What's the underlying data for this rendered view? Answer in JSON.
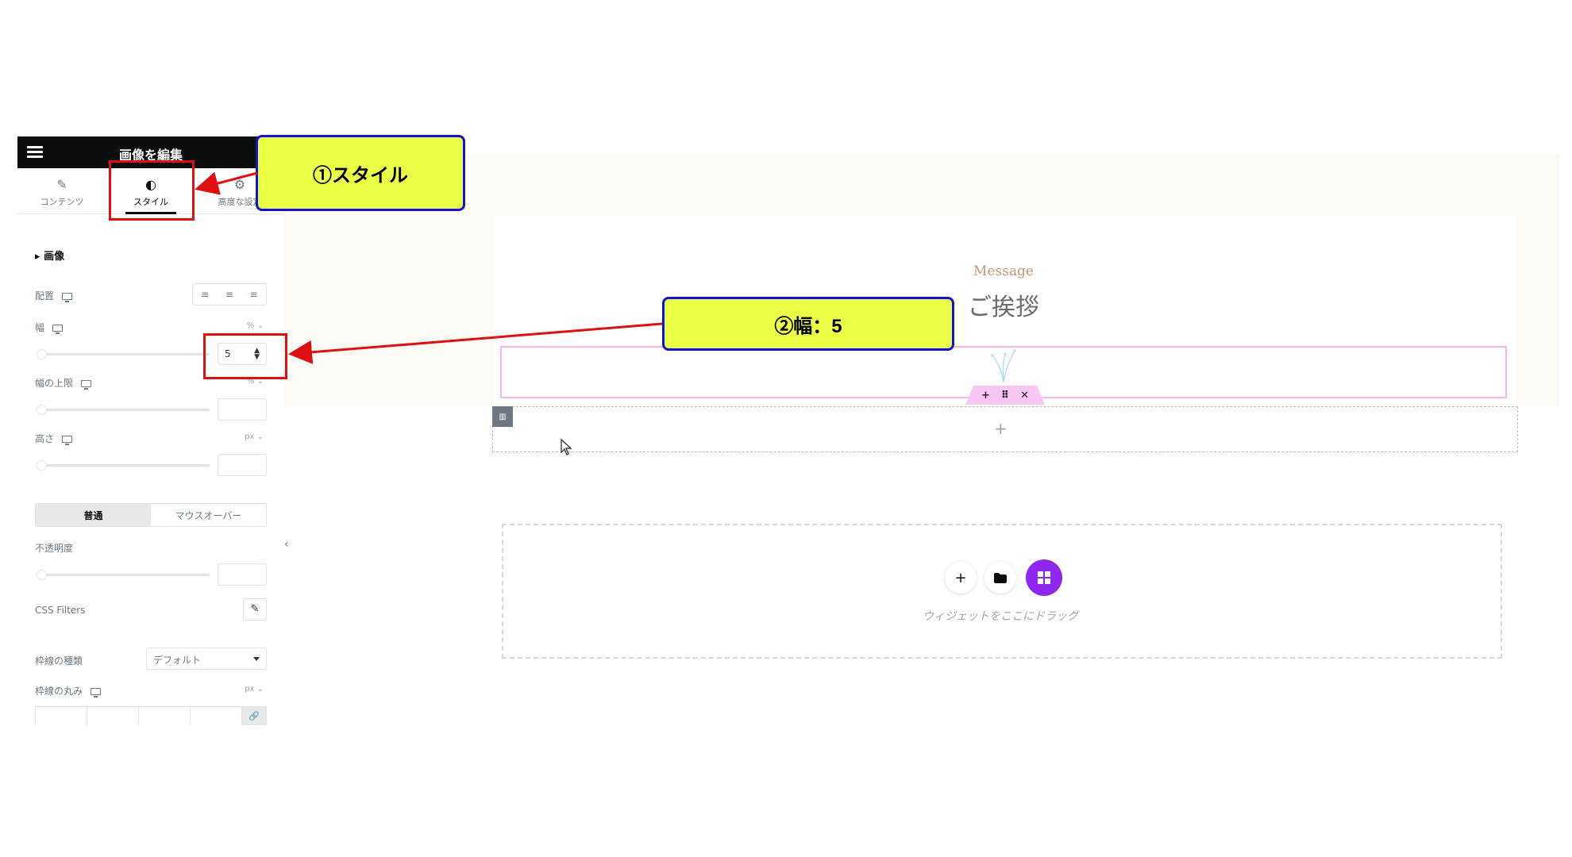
{
  "panel": {
    "title": "画像を編集",
    "tabs": [
      {
        "label": "コンテンツ",
        "icon": "pencil-icon"
      },
      {
        "label": "スタイル",
        "icon": "half-circle-icon",
        "active": true
      },
      {
        "label": "高度な設定",
        "icon": "gear-icon"
      }
    ],
    "section_title": "画像",
    "alignment_label": "配置",
    "width_label": "幅",
    "width_unit": "%",
    "width_value": "5",
    "max_width_label": "幅の上限",
    "max_width_unit": "%",
    "height_label": "高さ",
    "height_unit": "px",
    "state_tabs": [
      "普通",
      "マウスオーバー"
    ],
    "opacity_label": "不透明度",
    "css_filters_label": "CSS Filters",
    "border_type_label": "枠線の種類",
    "border_type_value": "デフォルト",
    "border_radius_label": "枠線の丸み",
    "border_radius_unit": "px"
  },
  "canvas": {
    "message_en": "Message",
    "message_jp": "ご挨拶",
    "widget_toolbar": [
      "+",
      "⠿",
      "✕"
    ],
    "row_add": "+",
    "drop_text": "ウィジェットをここにドラッグ"
  },
  "annotations": {
    "callout_1": "①スタイル",
    "callout_2": "②幅：5"
  },
  "colors": {
    "accent_purple": "#8e28f0",
    "highlight_red": "#e01010",
    "callout_yellow": "#ebff45",
    "callout_border": "#1313d8",
    "selection_pink": "#f3b6ef"
  }
}
